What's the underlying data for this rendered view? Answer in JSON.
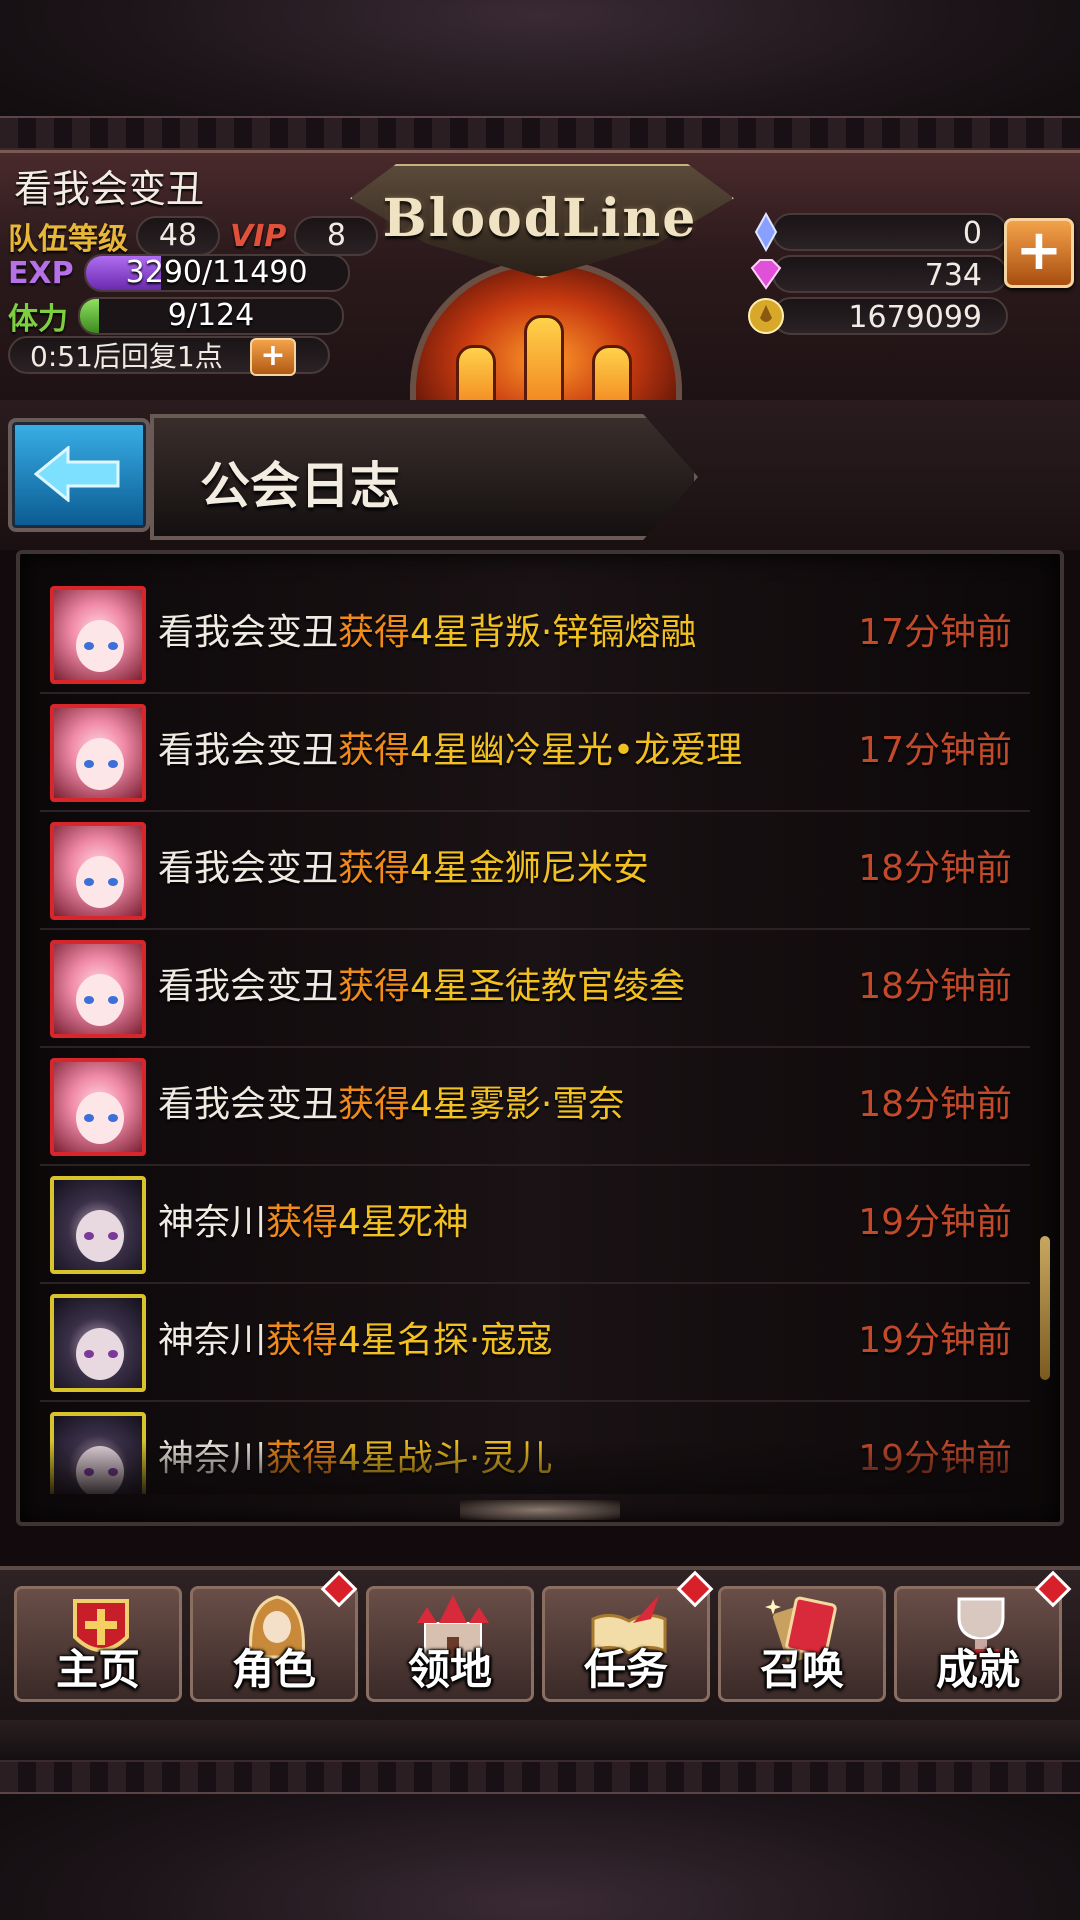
{
  "player": {
    "name": "看我会变丑",
    "team_level_label": "队伍等级",
    "team_level": "48",
    "vip_label": "VIP",
    "vip_level": "8",
    "exp_label": "EXP",
    "exp_text": "3290/11490",
    "exp_progress": 0.286,
    "stamina_label": "体力",
    "stamina_text": "9/124",
    "stamina_progress": 0.073,
    "recover_text": "0:51后回复1点"
  },
  "logo": {
    "text": "BloodLine"
  },
  "currency": {
    "crystal": "0",
    "diamond": "734",
    "gold": "1679099"
  },
  "header": {
    "title": "公会日志"
  },
  "log": {
    "entries": [
      {
        "who": "看我会变丑",
        "action": "获得",
        "item": "4星背叛·锌镉熔融",
        "time": "17分钟前",
        "avatar": "red"
      },
      {
        "who": "看我会变丑",
        "action": "获得",
        "item": "4星幽冷星光•龙爱理",
        "time": "17分钟前",
        "avatar": "red"
      },
      {
        "who": "看我会变丑",
        "action": "获得",
        "item": "4星金狮尼米安",
        "time": "18分钟前",
        "avatar": "red"
      },
      {
        "who": "看我会变丑",
        "action": "获得",
        "item": "4星圣徒教官绫叁",
        "time": "18分钟前",
        "avatar": "red"
      },
      {
        "who": "看我会变丑",
        "action": "获得",
        "item": "4星雾影·雪奈",
        "time": "18分钟前",
        "avatar": "red"
      },
      {
        "who": "神奈川",
        "action": "获得",
        "item": "4星死神",
        "time": "19分钟前",
        "avatar": "gold"
      },
      {
        "who": "神奈川",
        "action": "获得",
        "item": "4星名探·寇寇",
        "time": "19分钟前",
        "avatar": "gold"
      },
      {
        "who": "神奈川",
        "action": "获得",
        "item": "4星战斗·灵儿",
        "time": "19分钟前",
        "avatar": "gold"
      }
    ]
  },
  "nav": {
    "items": [
      {
        "label": "主页",
        "badge": false
      },
      {
        "label": "角色",
        "badge": true
      },
      {
        "label": "领地",
        "badge": false
      },
      {
        "label": "任务",
        "badge": true
      },
      {
        "label": "召唤",
        "badge": false
      },
      {
        "label": "成就",
        "badge": true
      }
    ]
  },
  "colors": {
    "accent_orange": "#f08a1a",
    "item_gold": "#f2c020",
    "time_red": "#c24a2a"
  }
}
